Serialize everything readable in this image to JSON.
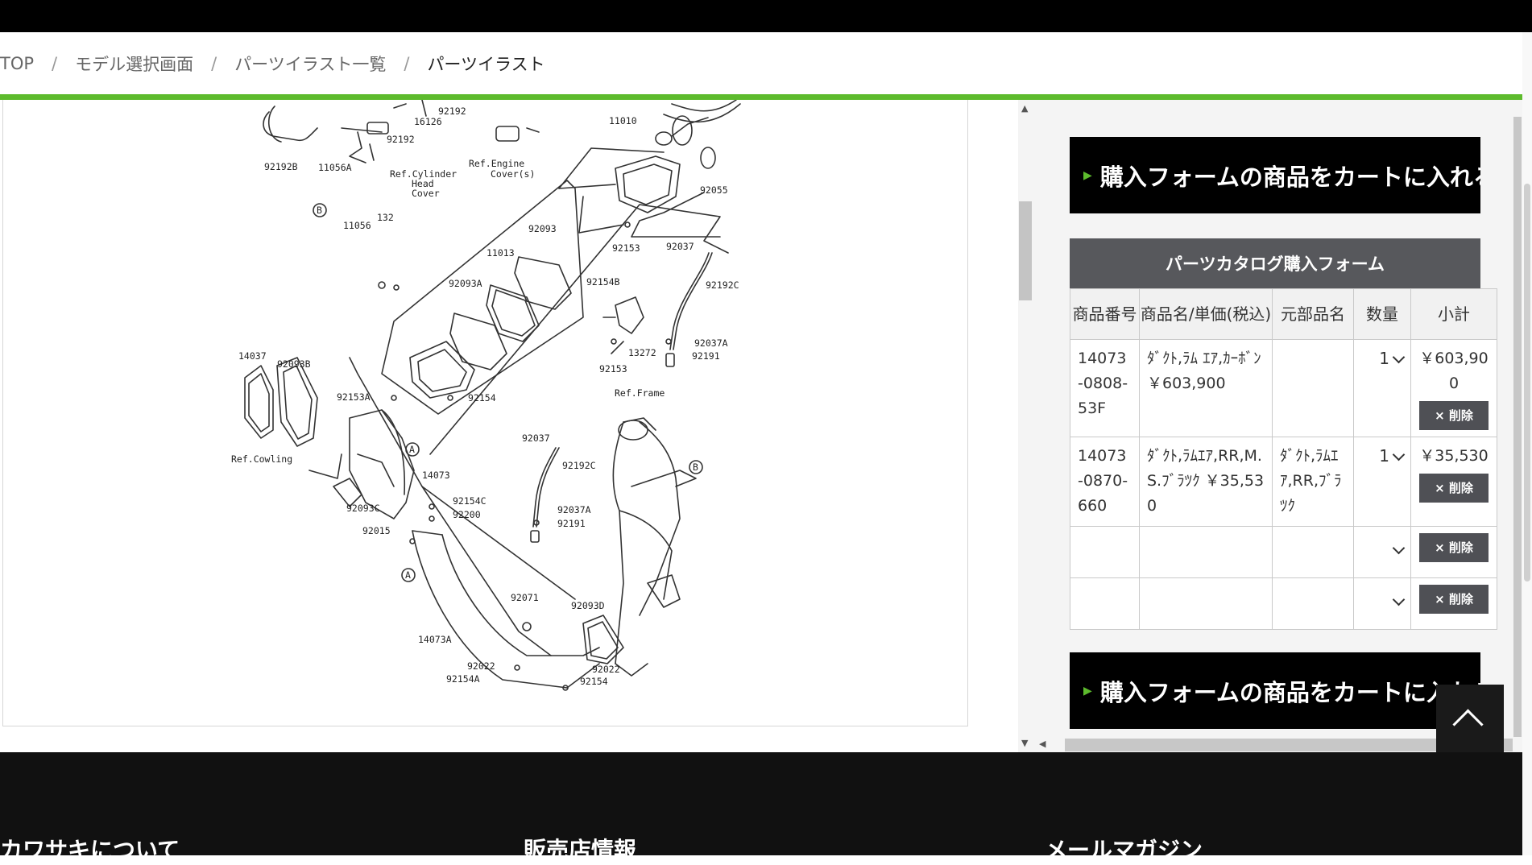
{
  "breadcrumb": {
    "items": [
      "TOP",
      "モデル選択画面",
      "パーツイラスト一覧"
    ],
    "current": "パーツイラスト",
    "separator": "/"
  },
  "illustration": {
    "labels": [
      "92192",
      "16126",
      "92192",
      "92192B",
      "11056A",
      "Ref.Cylinder",
      "Head",
      "Cover",
      "Ref.Engine",
      "Cover(s)",
      "11010",
      "92055",
      "B",
      "132",
      "11056",
      "92093",
      "11013",
      "92153",
      "92037",
      "92192C",
      "92093A",
      "92154B",
      "92037A",
      "92191",
      "13272",
      "92153",
      "Ref.Frame",
      "14037",
      "92093B",
      "92153A",
      "92154",
      "Ref.Cowling",
      "A",
      "14073",
      "92037",
      "92192C",
      "B",
      "92093C",
      "92154C",
      "92200",
      "92015",
      "92037A",
      "92191",
      "A",
      "92071",
      "92093D",
      "14073A",
      "92022",
      "92154A",
      "92022",
      "92154"
    ]
  },
  "sidebar": {
    "cart_button_label": "購入フォームの商品をカートに入れる",
    "form_title": "パーツカタログ購入フォーム",
    "columns": [
      "商品番号",
      "商品名/単価(税込)",
      "元部品名",
      "数量",
      "小計"
    ],
    "rows": [
      {
        "part_no": "14073-0808-53F",
        "name_price": "ﾀﾞｸﾄ,ﾗﾑ ｴｱ,ｶｰﾎﾞﾝ￥603,900",
        "orig_name": "",
        "qty": "1",
        "subtotal": "￥603,900",
        "delete": "× 削除"
      },
      {
        "part_no": "14073-0870-660",
        "name_price": "ﾀﾞｸﾄ,ﾗﾑｴｱ,RR,M.S.ﾌﾞﾗﾂｸ ￥35,530",
        "orig_name": "ﾀﾞｸﾄ,ﾗﾑｴｱ,RR,ﾌﾞﾗﾂｸ",
        "qty": "1",
        "subtotal": "￥35,530",
        "delete": "× 削除"
      },
      {
        "part_no": "",
        "name_price": "",
        "orig_name": "",
        "qty": "",
        "subtotal": "",
        "delete": "× 削除"
      },
      {
        "part_no": "",
        "name_price": "",
        "orig_name": "",
        "qty": "",
        "subtotal": "",
        "delete": "× 削除"
      }
    ]
  },
  "footer": {
    "columns": [
      "カワサキについて",
      "販売店情報",
      "メールマガジン"
    ]
  },
  "colors": {
    "accent_green": "#5dbb2d",
    "black": "#000000",
    "form_header": "#57585c"
  },
  "icons": {
    "to_top": "chevron-up-icon",
    "qty_select": "chevron-down-icon",
    "cart_bullet": "triangle-right-icon"
  }
}
